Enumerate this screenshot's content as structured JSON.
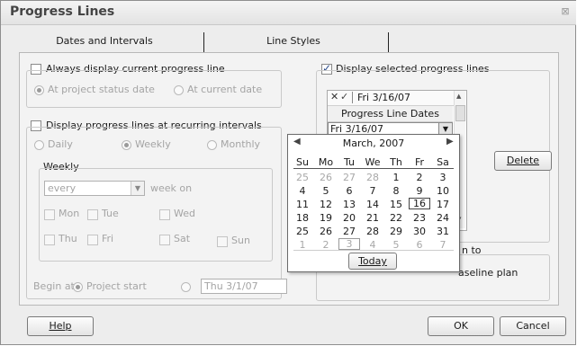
{
  "window": {
    "title": "Progress Lines",
    "close_glyph": "⊠"
  },
  "tabs": [
    {
      "label": "Dates and Intervals",
      "active": true
    },
    {
      "label": "Line Styles",
      "active": false
    }
  ],
  "left": {
    "always_display": "Always display current progress line",
    "at_status_date": "At project status date",
    "at_current_date": "At current date",
    "recurring": "Display progress lines at recurring intervals",
    "daily": "Daily",
    "weekly": "Weekly",
    "monthly": "Monthly",
    "weekly_group": "Weekly",
    "every_value": "every",
    "week_on": "week on",
    "days": [
      "Mon",
      "Tue",
      "Wed",
      "Thu",
      "Fri",
      "Sat",
      "Sun"
    ],
    "begin_at": "Begin at:",
    "project_start": "Project start",
    "begin_date": "Thu 3/1/07"
  },
  "right": {
    "display_selected": "Display selected progress lines",
    "entry_value": "Fri 3/16/07",
    "list_header": "Progress Line Dates",
    "selected_date": "Fri 3/16/07",
    "delete_label": "Delete",
    "relative_to_partial": "n to",
    "baseline_partial": "aseline plan"
  },
  "calendar": {
    "month_label": "March, 2007",
    "weekdays": [
      "Su",
      "Mo",
      "Tu",
      "We",
      "Th",
      "Fr",
      "Sa"
    ],
    "weeks": [
      [
        "25",
        "26",
        "27",
        "28",
        "1",
        "2",
        "3"
      ],
      [
        "4",
        "5",
        "6",
        "7",
        "8",
        "9",
        "10"
      ],
      [
        "11",
        "12",
        "13",
        "14",
        "15",
        "16",
        "17"
      ],
      [
        "18",
        "19",
        "20",
        "21",
        "22",
        "23",
        "24"
      ],
      [
        "25",
        "26",
        "27",
        "28",
        "29",
        "30",
        "31"
      ],
      [
        "1",
        "2",
        "3",
        "4",
        "5",
        "6",
        "7"
      ]
    ],
    "selected_day": "16",
    "today_label": "Today"
  },
  "footer": {
    "help": "Help",
    "ok": "OK",
    "cancel": "Cancel"
  }
}
